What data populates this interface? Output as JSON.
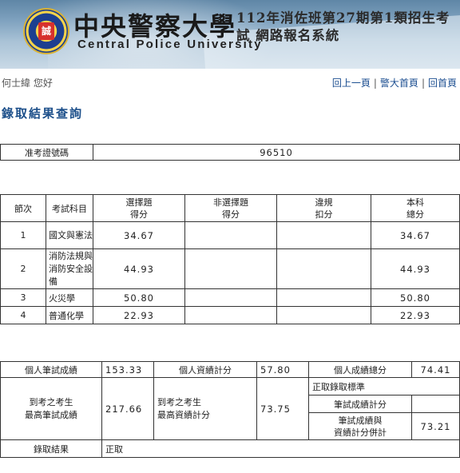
{
  "banner": {
    "badge_text": "誠",
    "school_cn": "中央警察大學",
    "school_en": "Central Police University",
    "system_title": "112年消佐班第27期第1類招生考試 網路報名系統"
  },
  "topbar": {
    "greeting": "何士緯 您好",
    "links": [
      "回上一頁",
      "警大首頁",
      "回首頁"
    ]
  },
  "page_title": "錄取結果查詢",
  "admission_ticket": {
    "label": "准考證號碼",
    "value": "96510"
  },
  "score_table": {
    "headers": [
      "節次",
      "考試科目",
      "選擇題\n得分",
      "非選擇題\n得分",
      "違規\n扣分",
      "本科\n總分"
    ],
    "rows": [
      {
        "period": "1",
        "subject": "國文與憲法",
        "choice": "34.67",
        "nonchoice": "",
        "penalty": "",
        "total": "34.67"
      },
      {
        "period": "2",
        "subject": "消防法規與消防安全設備",
        "choice": "44.93",
        "nonchoice": "",
        "penalty": "",
        "total": "44.93"
      },
      {
        "period": "3",
        "subject": "火災學",
        "choice": "50.80",
        "nonchoice": "",
        "penalty": "",
        "total": "50.80"
      },
      {
        "period": "4",
        "subject": "普通化學",
        "choice": "22.93",
        "nonchoice": "",
        "penalty": "",
        "total": "22.93"
      }
    ]
  },
  "summary": {
    "written_label": "個人筆試成績",
    "written_value": "153.33",
    "credential_label": "個人資績計分",
    "credential_value": "57.80",
    "total_label": "個人成績總分",
    "total_value": "74.41",
    "max_written_label": "到考之考生\n最高筆試成績",
    "max_written_value": "217.66",
    "max_credential_label": "到考之考生\n最高資績計分",
    "max_credential_value": "73.75",
    "standard_label": "正取錄取標準",
    "standard_written_label": "筆試成績計分",
    "standard_written_value": "",
    "standard_combined_label": "筆試成績與\n資績計分併計",
    "standard_combined_value": "73.21",
    "result_label": "錄取結果",
    "result_value": "正取"
  }
}
